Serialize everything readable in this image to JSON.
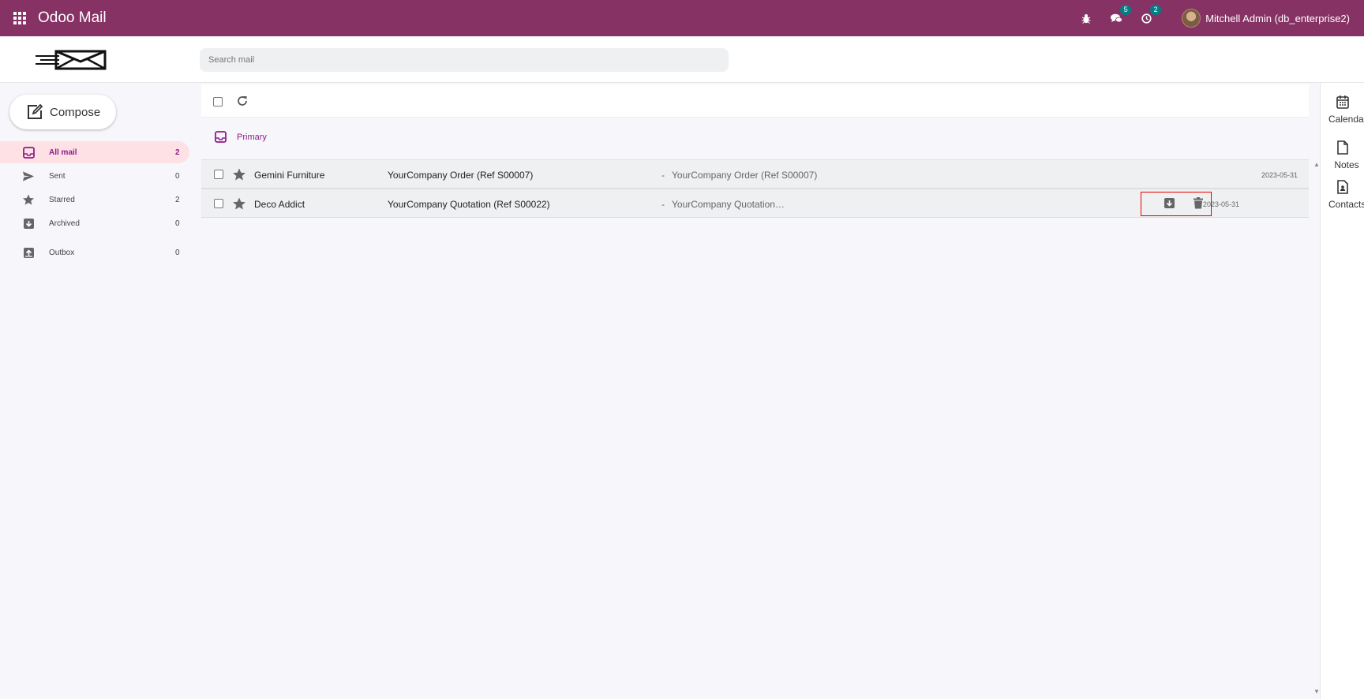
{
  "topbar": {
    "app_title": "Odoo Mail",
    "chat_badge": "5",
    "activity_badge": "2",
    "user_name": "Mitchell Admin (db_enterprise2)"
  },
  "search": {
    "placeholder": "Search mail"
  },
  "sidebar": {
    "compose_label": "Compose",
    "items": [
      {
        "label": "All mail",
        "count": "2",
        "icon": "inbox-icon"
      },
      {
        "label": "Sent",
        "count": "0",
        "icon": "send-icon"
      },
      {
        "label": "Starred",
        "count": "2",
        "icon": "star-icon"
      },
      {
        "label": "Archived",
        "count": "0",
        "icon": "archive-icon"
      },
      {
        "label": "Outbox",
        "count": "0",
        "icon": "outbox-icon"
      }
    ]
  },
  "tabs": [
    {
      "label": "Primary",
      "icon": "inbox-icon"
    }
  ],
  "emails": [
    {
      "sender": "Gemini Furniture",
      "subject": "YourCompany Order (Ref S00007)",
      "separator": "-",
      "preview": "YourCompany Order (Ref S00007)",
      "date": "2023-05-31"
    },
    {
      "sender": "Deco Addict",
      "subject": "YourCompany Quotation (Ref S00022)",
      "separator": "-",
      "preview": "YourCompany Quotation…",
      "date": "2023-05-31"
    }
  ],
  "right_panel": [
    {
      "label": "Calendar",
      "icon": "calendar-icon"
    },
    {
      "label": "Notes",
      "icon": "note-icon"
    },
    {
      "label": "Contacts",
      "icon": "contact-icon"
    }
  ],
  "colors": {
    "topbar": "#863264",
    "accent": "#8f1c8a",
    "active_bg": "#fde1e4",
    "badge": "#017e84",
    "highlight_box": "#ee0000"
  }
}
